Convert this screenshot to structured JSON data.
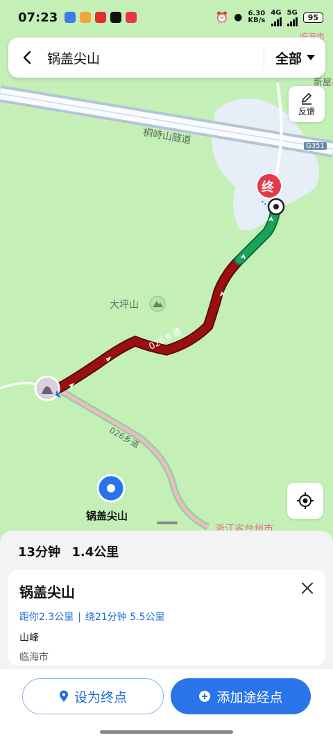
{
  "status": {
    "time": "07:23",
    "net_speed": "6.30",
    "net_unit": "KB/s",
    "sim1": "4G",
    "sim2": "5G",
    "battery": "95"
  },
  "search": {
    "query": "锅盖尖山",
    "filter_label": "全部"
  },
  "map": {
    "feedback_label": "反馈",
    "labels": {
      "tunnel": "桐峙山隧道",
      "highway": "G351",
      "mountain": "大坪山",
      "road_top": "026乡道",
      "road_bottom": "026乡道",
      "poi": "锅盖尖山",
      "province": "浙江省台州市",
      "corner_city": "临海市",
      "corner_place": "新屋村"
    },
    "end_marker": "终"
  },
  "route": {
    "duration": "13分钟",
    "distance": "1.4公里"
  },
  "place": {
    "name": "锅盖尖山",
    "distance_from_you": "距你2.3公里",
    "separator": "|",
    "detour": "绕21分钟 5.5公里",
    "category": "山峰",
    "city": "临海市"
  },
  "actions": {
    "set_destination": "设为终点",
    "add_waypoint": "添加途经点"
  },
  "colors": {
    "map_bg": "#c4f0b8",
    "route_slow": "#9b0f0f",
    "route_clear": "#1aa35a",
    "accent": "#2a74ea"
  }
}
